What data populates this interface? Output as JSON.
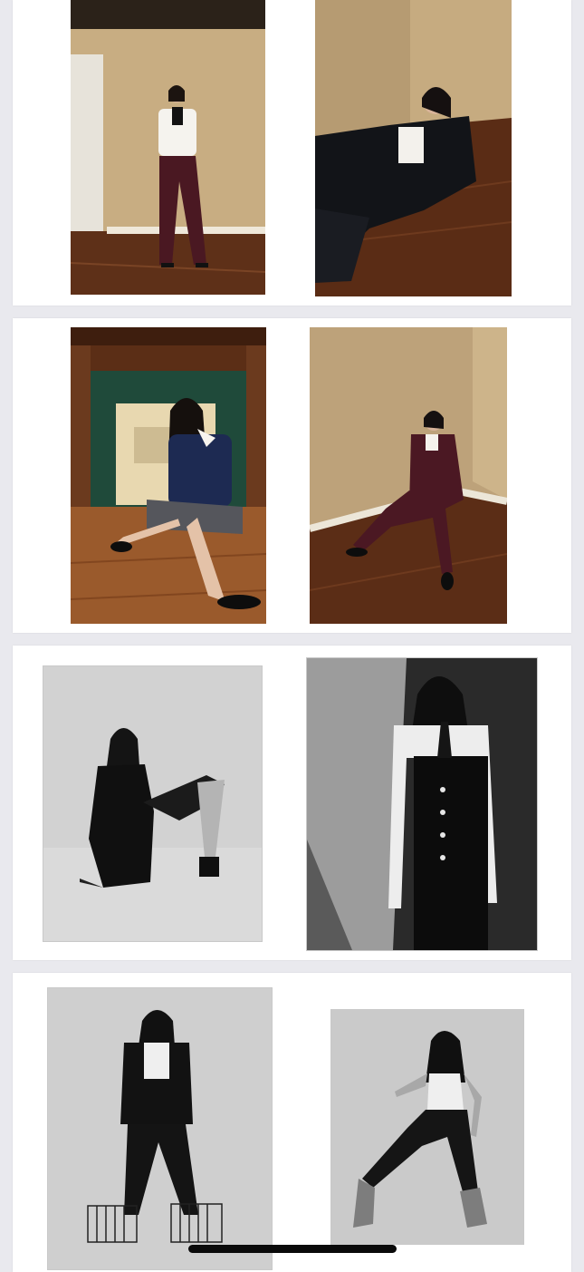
{
  "viewer": {
    "pages": [
      {
        "photos": [
          "color-photo-standing-white-shirt-burgundy-trousers",
          "color-photo-reclining-floor-black-suit"
        ]
      },
      {
        "photos": [
          "color-photo-fireplace-seated-navy-blazer",
          "color-photo-seated-chair-burgundy-suit"
        ]
      },
      {
        "photos": [
          "bw-photo-seated-floor-black-coat",
          "bw-photo-standing-corset-dress"
        ]
      },
      {
        "photos": [
          "bw-photo-standing-on-crates-suit",
          "bw-photo-wide-stance-jeans-boots"
        ]
      }
    ]
  },
  "colors": {
    "background": "#e9e9ee",
    "card": "#ffffff",
    "wall_beige": "#c9ae83",
    "floor_wood": "#6b3b1f",
    "burgundy": "#4e1a25",
    "home_indicator": "#0a0a0a"
  }
}
